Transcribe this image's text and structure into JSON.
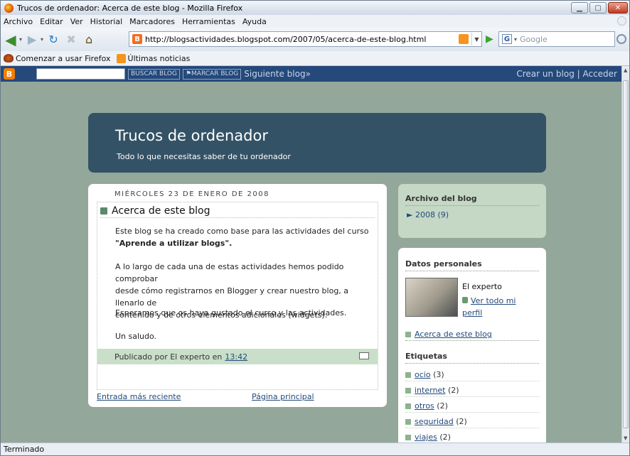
{
  "window": {
    "title": "Trucos de ordenador: Acerca de este blog - Mozilla Firefox"
  },
  "menu": [
    "Archivo",
    "Editar",
    "Ver",
    "Historial",
    "Marcadores",
    "Herramientas",
    "Ayuda"
  ],
  "nav": {
    "url": "http://blogsactividades.blogspot.com/2007/05/acerca-de-este-blog.html",
    "search_placeholder": "Google"
  },
  "bookmarks": {
    "item1": "Comenzar a usar Firefox",
    "item2": "Últimas noticias"
  },
  "blogger_nav": {
    "search_btn": "BUSCAR BLOG",
    "flag_btn": "MARCAR BLOG",
    "next": "Siguiente blog»",
    "right": "Crear un blog | Acceder"
  },
  "header": {
    "title": "Trucos de ordenador",
    "description": "Todo lo que necesitas saber de tu ordenador"
  },
  "post": {
    "date": "MIÉRCOLES 23 DE ENERO DE 2008",
    "title": "Acerca de este blog",
    "p1a": "Este blog se ha creado como base para las actividades del curso",
    "p1b": "\"Aprende a utilizar blogs\".",
    "p2a": "A lo largo de cada una de estas actividades hemos podido comprobar",
    "p2b": "desde cómo registrarnos en Blogger y crear nuestro blog, a llenarlo de",
    "p2c": "contenido y de otros elementos adicionales (widgets).",
    "p3": "Esperamos que os haya gustado el curso y las actividades.",
    "p4": "Un saludo.",
    "published_by": "Publicado por El experto en",
    "time": "13:42",
    "newer": "Entrada más reciente",
    "home": "Página principal"
  },
  "archive": {
    "heading": "Archivo del blog",
    "year": "2008",
    "count": "(9)"
  },
  "profile": {
    "heading": "Datos personales",
    "name": "El experto",
    "view": "Ver todo mi perfil",
    "page_link": "Acerca de este blog"
  },
  "labels": {
    "heading": "Etiquetas",
    "items": [
      {
        "name": "ocio",
        "count": "(3)"
      },
      {
        "name": "internet",
        "count": "(2)"
      },
      {
        "name": "otros",
        "count": "(2)"
      },
      {
        "name": "seguridad",
        "count": "(2)"
      },
      {
        "name": "viajes",
        "count": "(2)"
      }
    ]
  },
  "status": "Terminado"
}
